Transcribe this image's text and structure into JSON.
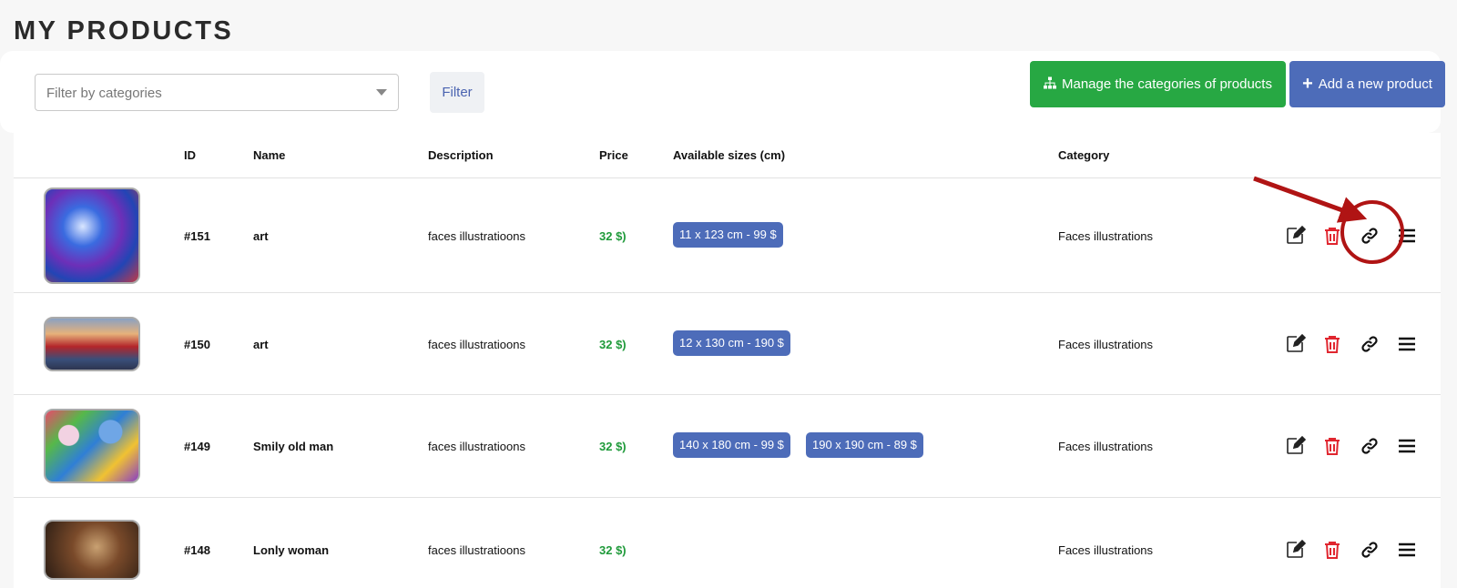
{
  "page": {
    "title": "MY PRODUCTS"
  },
  "toolbar": {
    "filter_placeholder": "Filter by categories",
    "filter_button": "Filter",
    "manage_categories_button": "Manage the categories of products",
    "add_product_button": "Add a new product"
  },
  "table": {
    "headers": {
      "id": "ID",
      "name": "Name",
      "description": "Description",
      "price": "Price",
      "sizes": "Available sizes (cm)",
      "category": "Category"
    },
    "rows": [
      {
        "id": "#151",
        "name": "art",
        "description": "faces illustratioons",
        "price": "32 $)",
        "sizes": [
          "11  x  123 cm - 99 $"
        ],
        "category": "Faces illustrations"
      },
      {
        "id": "#150",
        "name": "art",
        "description": "faces illustratioons",
        "price": "32 $)",
        "sizes": [
          "12  x  130 cm - 190 $"
        ],
        "category": "Faces illustrations"
      },
      {
        "id": "#149",
        "name": "Smily old man",
        "description": "faces illustratioons",
        "price": "32 $)",
        "sizes": [
          "140  x  180 cm - 99 $",
          "190  x  190 cm - 89 $"
        ],
        "category": "Faces illustrations"
      },
      {
        "id": "#148",
        "name": "Lonly woman",
        "description": "faces illustratioons",
        "price": "32 $)",
        "sizes": [],
        "category": "Faces illustrations"
      }
    ]
  },
  "row_actions": [
    "edit-icon",
    "trash-icon",
    "link-icon",
    "menu-icon"
  ],
  "colors": {
    "green_button": "#27a843",
    "blue_button": "#4d6cb9",
    "price": "#1f9a3a",
    "delete": "#e0262f",
    "annotation": "#b01414"
  }
}
